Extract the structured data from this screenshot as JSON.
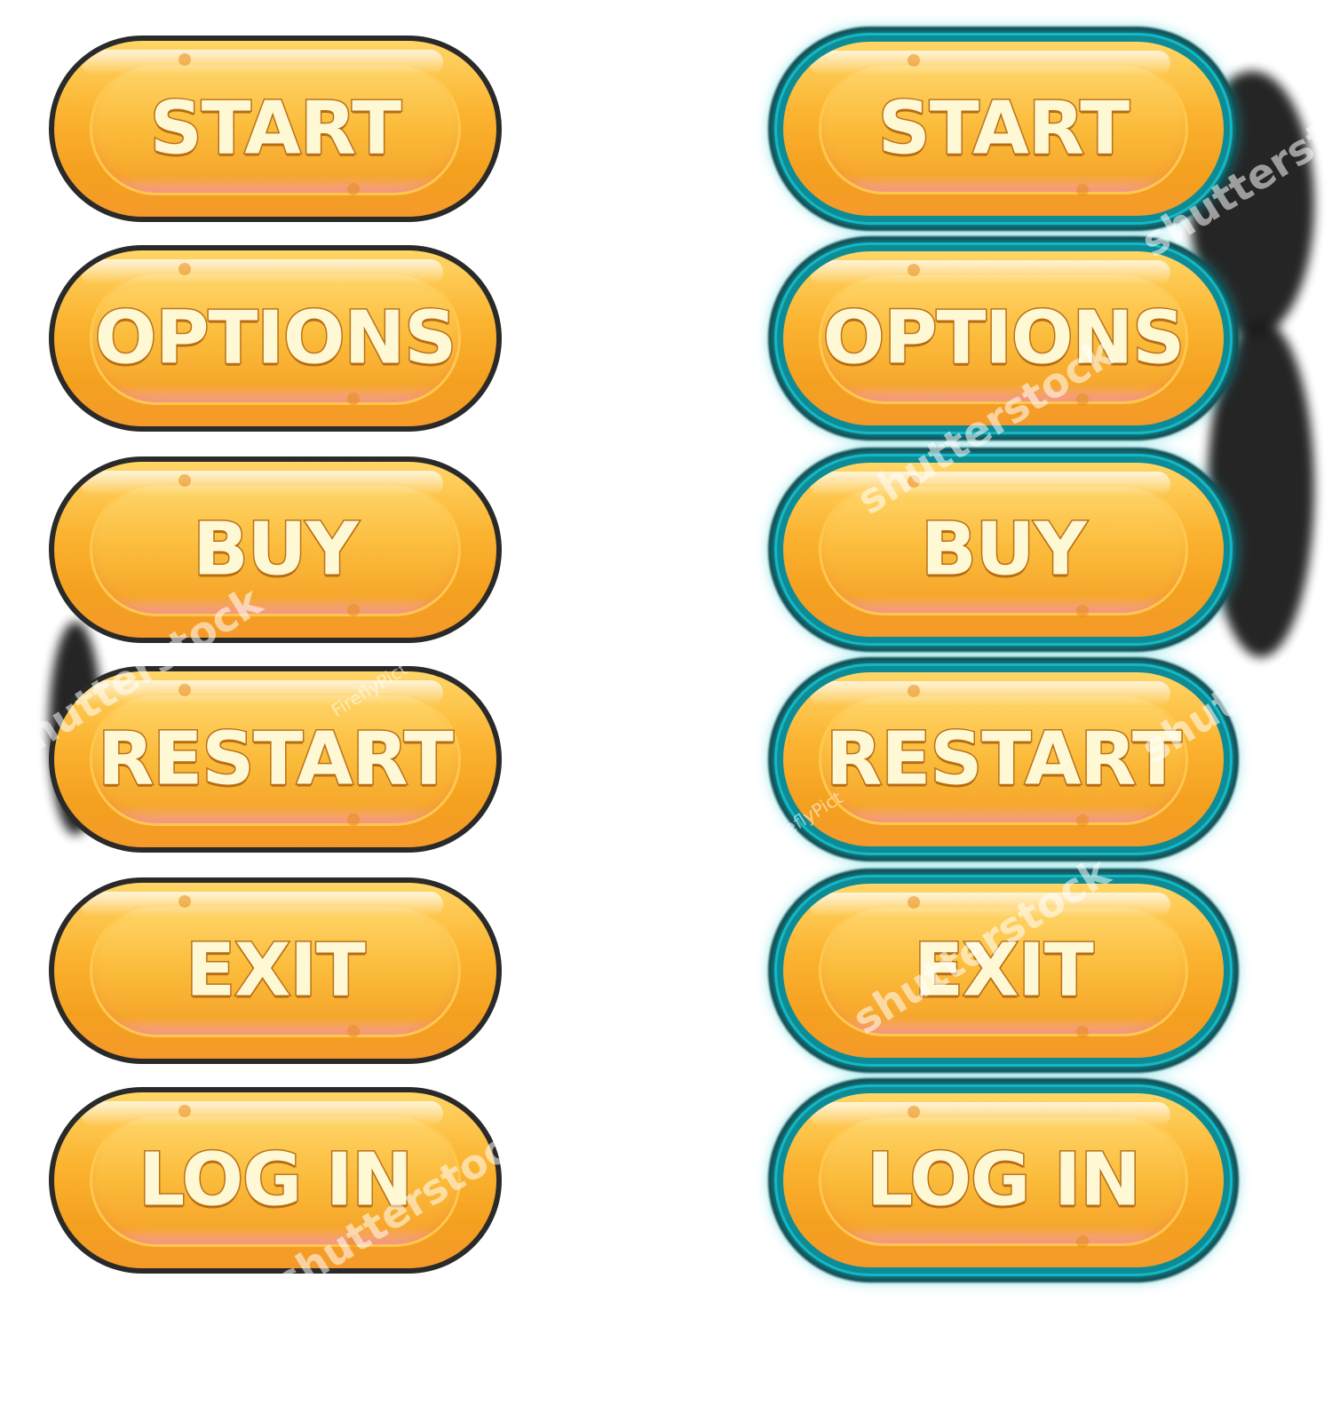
{
  "colors": {
    "button_fill": "#fbb431",
    "label_fill": "#fff8d4",
    "label_stroke": "#b9731a",
    "left_rim": "#2a2a2a",
    "right_rim_glow": "#14b8c4"
  },
  "left_column": {
    "buttons": [
      {
        "label": "START"
      },
      {
        "label": "OPTIONS"
      },
      {
        "label": "BUY"
      },
      {
        "label": "RESTART"
      },
      {
        "label": "EXIT"
      },
      {
        "label": "LOG IN"
      }
    ]
  },
  "right_column": {
    "buttons": [
      {
        "label": "START"
      },
      {
        "label": "OPTIONS"
      },
      {
        "label": "BUY"
      },
      {
        "label": "RESTART"
      },
      {
        "label": "EXIT"
      },
      {
        "label": "LOG IN"
      }
    ]
  },
  "watermarks": {
    "shutterstock": "shutterstock",
    "firefly": "FireflyPict"
  }
}
